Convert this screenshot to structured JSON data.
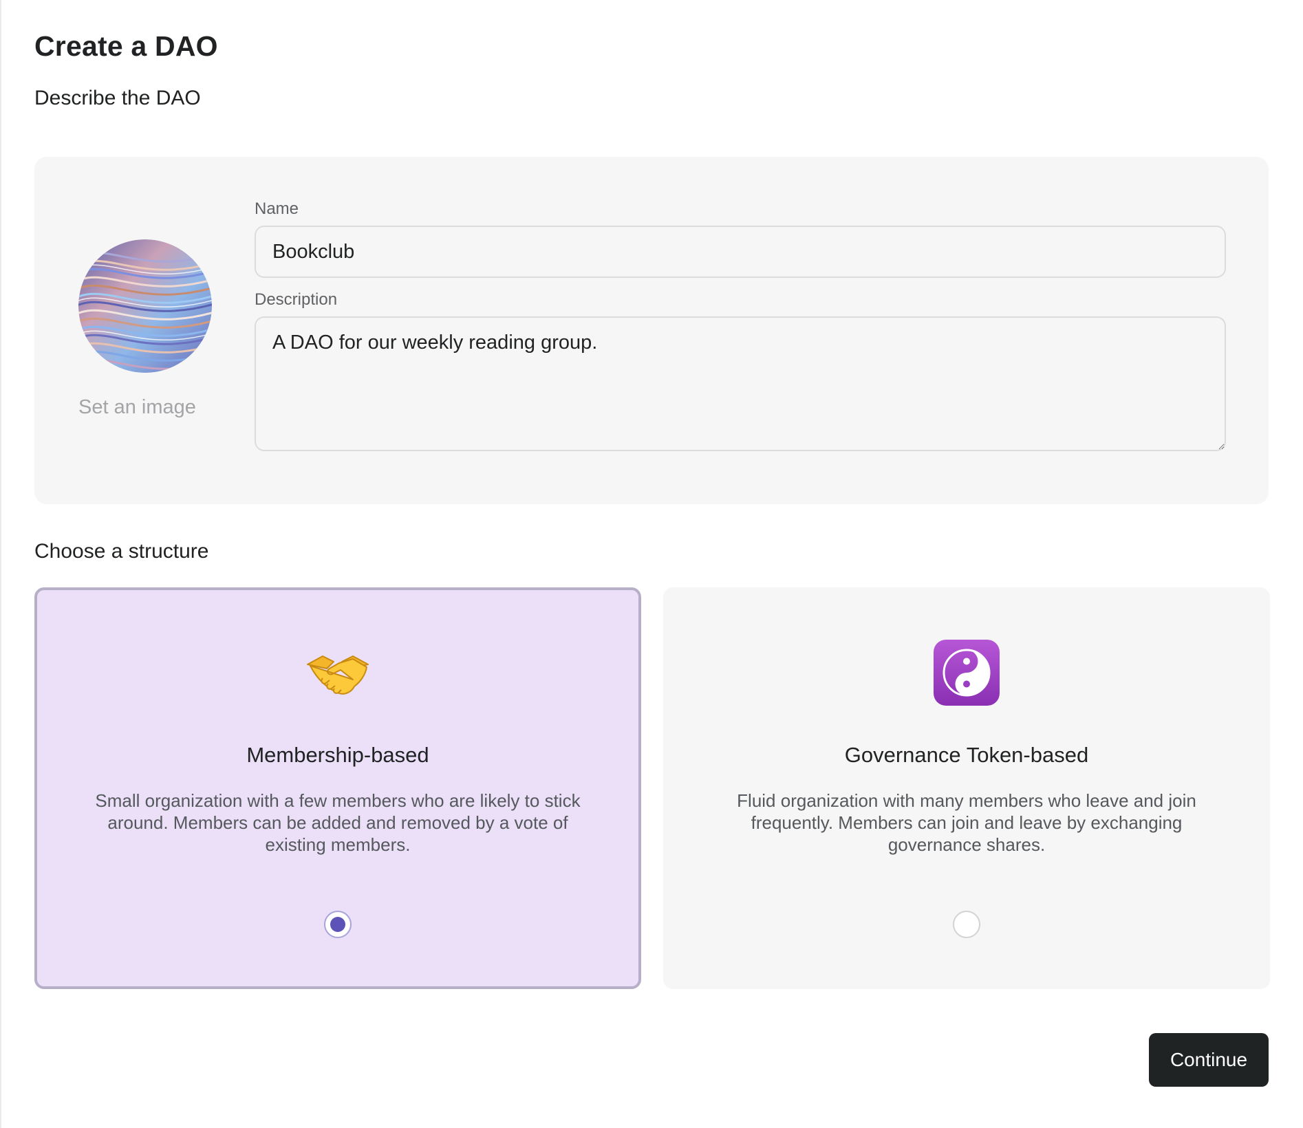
{
  "page": {
    "title": "Create a DAO"
  },
  "describe": {
    "heading": "Describe the DAO",
    "image": {
      "set_label": "Set an image"
    },
    "name": {
      "label": "Name",
      "value": "Bookclub"
    },
    "description": {
      "label": "Description",
      "value": "A DAO for our weekly reading group."
    }
  },
  "structure": {
    "heading": "Choose a structure",
    "options": [
      {
        "icon": "handshake-icon",
        "title": "Membership-based",
        "description": "Small organization with a few members who are likely to stick around. Members can be added and removed by a vote of existing members.",
        "selected": true
      },
      {
        "icon": "yin-yang-icon",
        "title": "Governance Token-based",
        "description": "Fluid organization with many members who leave and join frequently. Members can join and leave by exchanging governance shares.",
        "selected": false
      }
    ]
  },
  "actions": {
    "continue_label": "Continue"
  },
  "colors": {
    "selected_card_bg": "#ebe0f8",
    "selected_card_border": "#b7afc7",
    "radio_accent": "#5b53b7",
    "primary_button_bg": "#202324",
    "card_bg": "#f6f6f6"
  }
}
